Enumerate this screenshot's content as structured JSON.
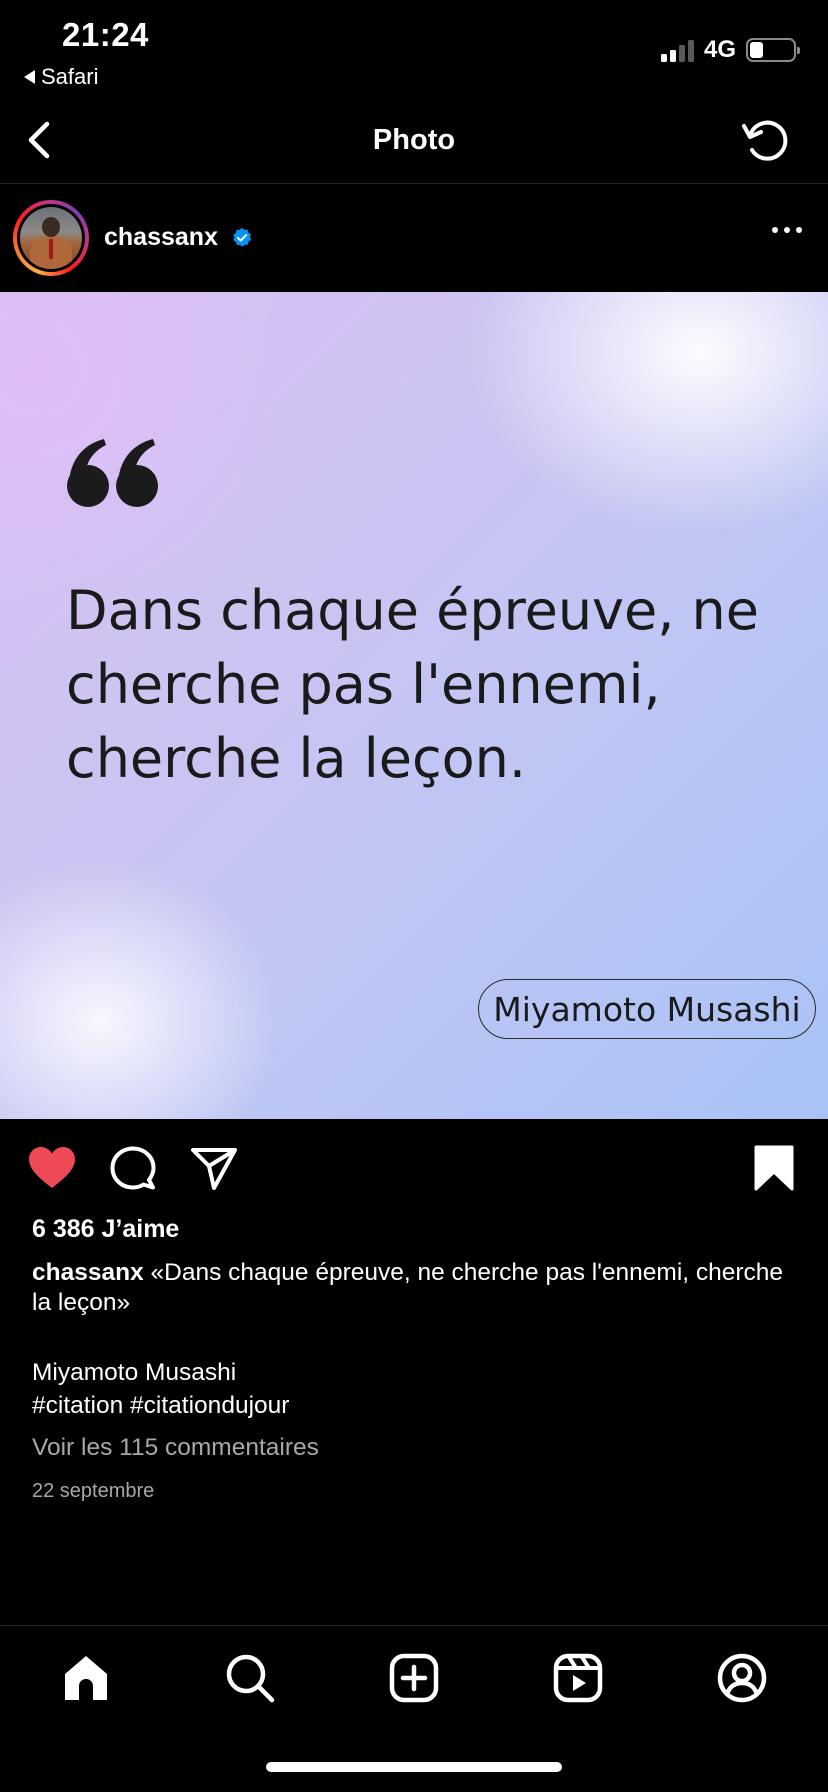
{
  "status_bar": {
    "time": "21:24",
    "back_app": "Safari",
    "network": "4G"
  },
  "nav": {
    "title": "Photo"
  },
  "post": {
    "username": "chassanx",
    "image": {
      "quote": "Dans chaque épreuve, ne cherche pas l'ennemi, cherche la leçon.",
      "author": "Miyamoto Musashi"
    },
    "likes": "6 386 J’aime",
    "caption_username": "chassanx",
    "caption_text": "«Dans chaque épreuve, ne cherche pas l'ennemi, cherche la leçon»",
    "caption_author": "Miyamoto Musashi",
    "hashtags": "#citation #citationdujour",
    "comments_link": "Voir les 115 commentaires",
    "date": "22 septembre",
    "liked": true,
    "saved": true
  },
  "icons": {
    "nav": [
      "chevron-left-icon",
      "refresh-icon"
    ],
    "actions": [
      "heart-icon",
      "comment-icon",
      "share-icon",
      "bookmark-icon"
    ],
    "tabs": [
      "home-icon",
      "search-icon",
      "create-icon",
      "reels-icon",
      "profile-icon"
    ]
  },
  "colors": {
    "like": "#ed4956",
    "verified": "#0095f6",
    "background": "#000000",
    "secondary_text": "#a8a8a8"
  }
}
